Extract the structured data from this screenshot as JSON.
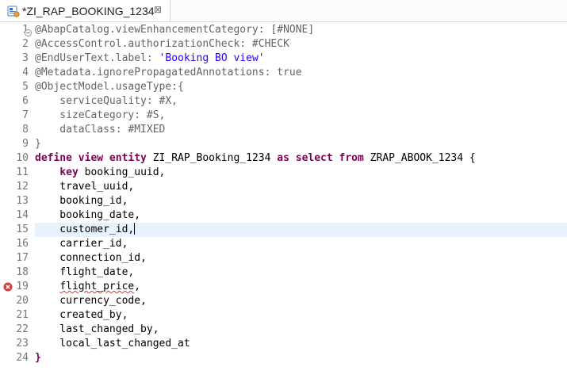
{
  "tab": {
    "title": "*ZI_RAP_BOOKING_1234",
    "icon": "cds-view-icon",
    "close_glyph": "⊠"
  },
  "editor": {
    "lines": [
      {
        "n": "1",
        "tokens": [
          {
            "t": "@AbapCatalog.viewEnhancementCategory: [#NONE]",
            "c": "ann"
          }
        ],
        "fold": true
      },
      {
        "n": "2",
        "tokens": [
          {
            "t": "@AccessControl.authorizationCheck: #CHECK",
            "c": "ann"
          }
        ]
      },
      {
        "n": "3",
        "tokens": [
          {
            "t": "@EndUserText.label: ",
            "c": "ann"
          },
          {
            "t": "'Booking BO view'",
            "c": "str"
          }
        ]
      },
      {
        "n": "4",
        "tokens": [
          {
            "t": "@Metadata.ignorePropagatedAnnotations: true",
            "c": "ann"
          }
        ]
      },
      {
        "n": "5",
        "tokens": [
          {
            "t": "@ObjectModel.usageType:{",
            "c": "ann"
          }
        ]
      },
      {
        "n": "6",
        "tokens": [
          {
            "t": "    serviceQuality: #X,",
            "c": "ann"
          }
        ]
      },
      {
        "n": "7",
        "tokens": [
          {
            "t": "    sizeCategory: #S,",
            "c": "ann"
          }
        ]
      },
      {
        "n": "8",
        "tokens": [
          {
            "t": "    dataClass: #MIXED",
            "c": "ann"
          }
        ]
      },
      {
        "n": "9",
        "tokens": [
          {
            "t": "}",
            "c": "ann"
          }
        ]
      },
      {
        "n": "10",
        "tokens": [
          {
            "t": "define view entity",
            "c": "kw"
          },
          {
            "t": " ZI_RAP_Booking_1234 ",
            "c": ""
          },
          {
            "t": "as select from",
            "c": "kw"
          },
          {
            "t": " ZRAP_ABOOK_1234 {",
            "c": ""
          }
        ]
      },
      {
        "n": "11",
        "tokens": [
          {
            "t": "    ",
            "c": ""
          },
          {
            "t": "key",
            "c": "kw"
          },
          {
            "t": " booking_uuid,",
            "c": ""
          }
        ]
      },
      {
        "n": "12",
        "tokens": [
          {
            "t": "    travel_uuid,",
            "c": ""
          }
        ]
      },
      {
        "n": "13",
        "tokens": [
          {
            "t": "    booking_id,",
            "c": ""
          }
        ]
      },
      {
        "n": "14",
        "tokens": [
          {
            "t": "    booking_date,",
            "c": ""
          }
        ]
      },
      {
        "n": "15",
        "tokens": [
          {
            "t": "    customer_id,",
            "c": ""
          }
        ],
        "current": true
      },
      {
        "n": "16",
        "tokens": [
          {
            "t": "    carrier_id,",
            "c": ""
          }
        ]
      },
      {
        "n": "17",
        "tokens": [
          {
            "t": "    connection_id,",
            "c": ""
          }
        ]
      },
      {
        "n": "18",
        "tokens": [
          {
            "t": "    flight_date,",
            "c": ""
          }
        ]
      },
      {
        "n": "19",
        "tokens": [
          {
            "t": "    ",
            "c": ""
          },
          {
            "t": "flight_price",
            "c": "err"
          },
          {
            "t": ",",
            "c": ""
          }
        ],
        "error": true
      },
      {
        "n": "20",
        "tokens": [
          {
            "t": "    currency_code,",
            "c": ""
          }
        ]
      },
      {
        "n": "21",
        "tokens": [
          {
            "t": "    created_by,",
            "c": ""
          }
        ]
      },
      {
        "n": "22",
        "tokens": [
          {
            "t": "    last_changed_by,",
            "c": ""
          }
        ]
      },
      {
        "n": "23",
        "tokens": [
          {
            "t": "    local_last_changed_at",
            "c": ""
          }
        ]
      },
      {
        "n": "24",
        "tokens": [
          {
            "t": "}",
            "c": "kw"
          }
        ]
      }
    ]
  },
  "colors": {
    "annotation": "#646464",
    "string": "#2a00ff",
    "keyword": "#7f0055",
    "current_line": "#e8f2fe",
    "error": "#d63b3b"
  }
}
